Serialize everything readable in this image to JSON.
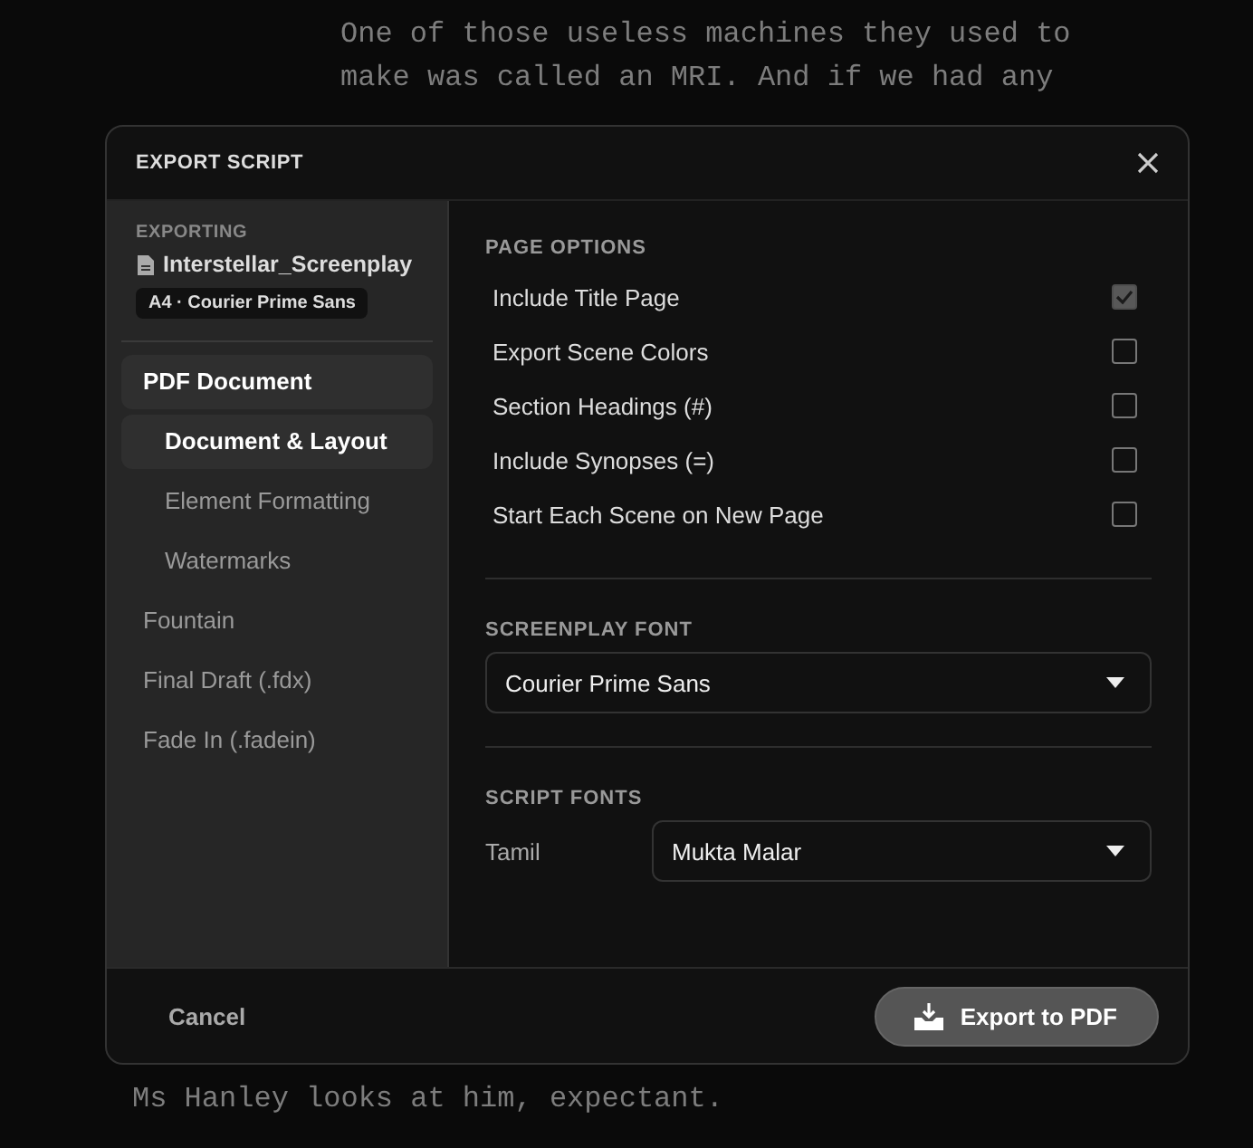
{
  "background_script": {
    "top_lines": [
      "One of those useless machines they used to",
      "make was called an MRI. And if we had any"
    ],
    "bottom_line": "Ms Hanley looks at him, expectant."
  },
  "dialog": {
    "title": "EXPORT SCRIPT",
    "sidebar": {
      "label": "EXPORTING",
      "file": "Interstellar_Screenplay",
      "badge": "A4 · Courier Prime Sans",
      "items": [
        {
          "label": "PDF Document",
          "selected": true,
          "children": [
            {
              "label": "Document & Layout",
              "selected": true
            },
            {
              "label": "Element Formatting",
              "selected": false
            },
            {
              "label": "Watermarks",
              "selected": false
            }
          ]
        },
        {
          "label": "Fountain",
          "selected": false
        },
        {
          "label": "Final Draft (.fdx)",
          "selected": false
        },
        {
          "label": "Fade In (.fadein)",
          "selected": false
        }
      ]
    },
    "page_options": {
      "heading": "PAGE OPTIONS",
      "options": [
        {
          "label": "Include Title Page",
          "checked": true,
          "disabled": true
        },
        {
          "label": "Export Scene Colors",
          "checked": false,
          "disabled": false
        },
        {
          "label": "Section Headings (#)",
          "checked": false,
          "disabled": false
        },
        {
          "label": "Include Synopses (=)",
          "checked": false,
          "disabled": false
        },
        {
          "label": "Start Each Scene on New Page",
          "checked": false,
          "disabled": false
        }
      ]
    },
    "screenplay_font": {
      "heading": "SCREENPLAY FONT",
      "value": "Courier Prime Sans"
    },
    "script_fonts": {
      "heading": "SCRIPT FONTS",
      "rows": [
        {
          "label": "Tamil",
          "value": "Mukta Malar"
        }
      ]
    },
    "buttons": {
      "cancel": "Cancel",
      "export": "Export to PDF"
    }
  }
}
